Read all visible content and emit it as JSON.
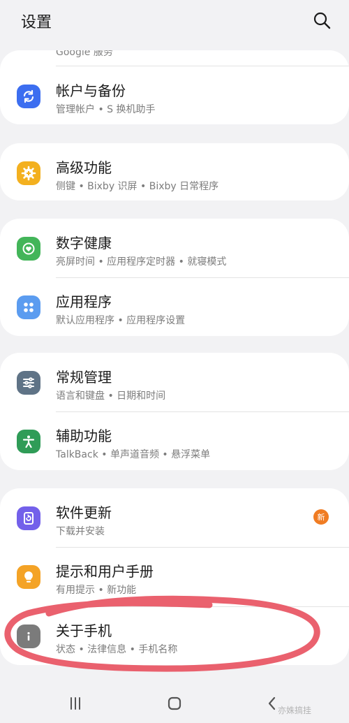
{
  "header": {
    "title": "设置",
    "search_icon": "search-icon"
  },
  "partial_row": {
    "subtitle": "Google 服务"
  },
  "items": [
    {
      "title": "帐户与备份",
      "subtitle": "管理帐户 • S 换机助手",
      "icon": "sync-icon",
      "icon_color": "#3c6ef0"
    },
    {
      "title": "高级功能",
      "subtitle": "侧键 • Bixby 识屏 • Bixby 日常程序",
      "icon": "gear-plus-icon",
      "icon_color": "#f3b01f"
    },
    {
      "title": "数字健康",
      "subtitle": "亮屏时间 • 应用程序定时器 • 就寝模式",
      "icon": "heart-circle-icon",
      "icon_color": "#43b559"
    },
    {
      "title": "应用程序",
      "subtitle": "默认应用程序 • 应用程序设置",
      "icon": "apps-grid-icon",
      "icon_color": "#5b9cf0"
    },
    {
      "title": "常规管理",
      "subtitle": "语言和键盘 • 日期和时间",
      "icon": "sliders-icon",
      "icon_color": "#5f7386"
    },
    {
      "title": "辅助功能",
      "subtitle": "TalkBack • 单声道音频 • 悬浮菜单",
      "icon": "accessibility-icon",
      "icon_color": "#2f9c57"
    },
    {
      "title": "软件更新",
      "subtitle": "下载并安装",
      "icon": "update-icon",
      "icon_color": "#7360ea",
      "badge": "新"
    },
    {
      "title": "提示和用户手册",
      "subtitle": "有用提示 • 新功能",
      "icon": "lightbulb-icon",
      "icon_color": "#f4a326"
    },
    {
      "title": "关于手机",
      "subtitle": "状态 • 法律信息 • 手机名称",
      "icon": "info-icon",
      "icon_color": "#7b7b7b"
    }
  ],
  "navbar": {
    "buttons": [
      "recent-apps-icon",
      "home-icon",
      "back-icon"
    ]
  },
  "watermark": "亦姝搞挂",
  "annotation_color": "#e8505e"
}
